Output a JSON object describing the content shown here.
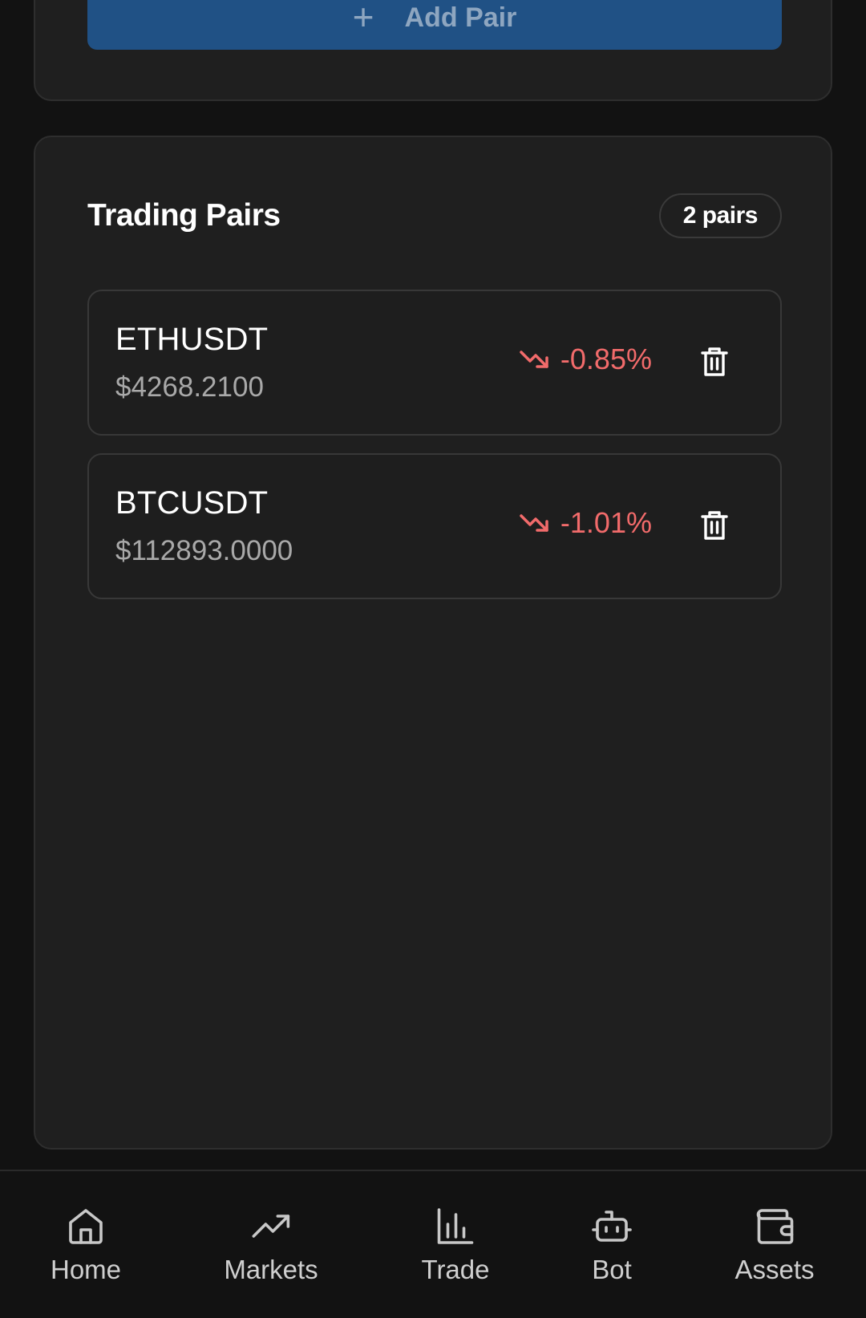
{
  "add_pair": {
    "label": "Add Pair",
    "plus": "+"
  },
  "trading_pairs": {
    "title": "Trading Pairs",
    "count_badge": "2 pairs",
    "items": [
      {
        "symbol": "ETHUSDT",
        "price": "$4268.2100",
        "change": "-0.85%",
        "direction": "down"
      },
      {
        "symbol": "BTCUSDT",
        "price": "$112893.0000",
        "change": "-1.01%",
        "direction": "down"
      }
    ]
  },
  "nav": {
    "items": [
      {
        "label": "Home",
        "icon": "home-icon"
      },
      {
        "label": "Markets",
        "icon": "trending-up-icon"
      },
      {
        "label": "Trade",
        "icon": "bar-chart-icon"
      },
      {
        "label": "Bot",
        "icon": "bot-icon"
      },
      {
        "label": "Assets",
        "icon": "wallet-icon"
      }
    ]
  },
  "colors": {
    "background": "#121212",
    "card": "#1f1f1f",
    "accent_button": "#205185",
    "negative": "#f26b6b"
  }
}
